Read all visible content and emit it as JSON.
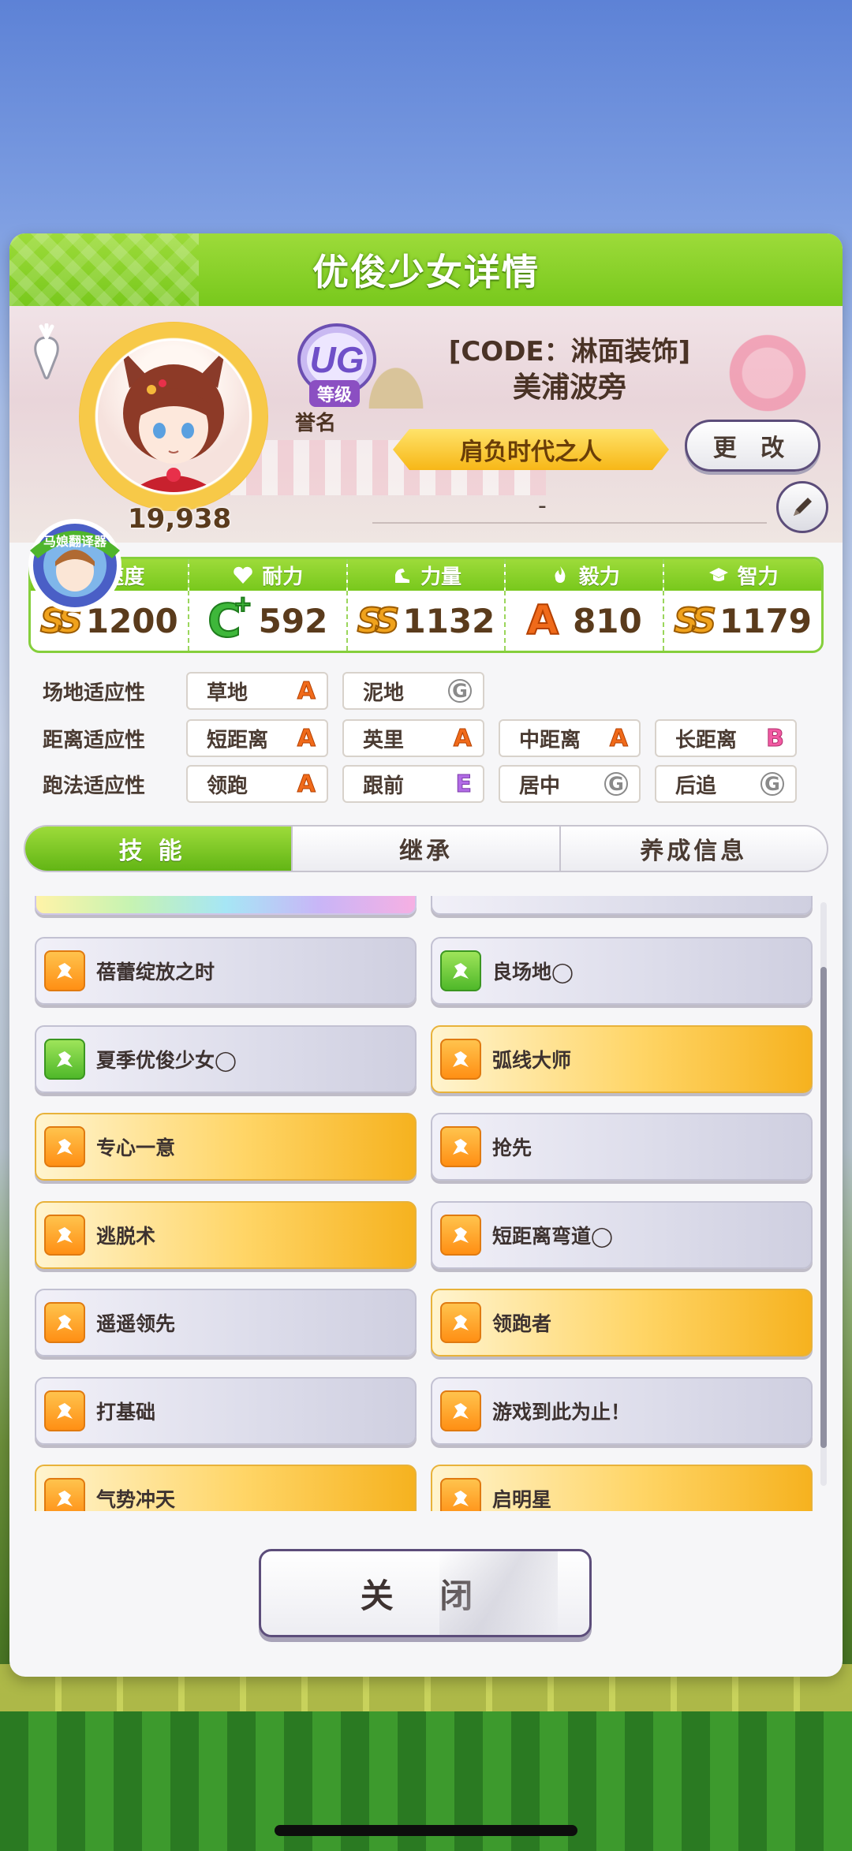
{
  "dialog": {
    "title": "优俊少女详情"
  },
  "profile": {
    "fans": "19,938",
    "rank_emblem_text": "UG",
    "rank_label": "等级",
    "honor_label": "誉名",
    "costume": "[CODE：淋面装饰]",
    "name": "美浦波旁",
    "title_plate": "肩负时代之人",
    "change_button": "更 改",
    "comment": "-"
  },
  "badge": {
    "text": "马娘翻译器"
  },
  "stats": [
    {
      "label": "速度",
      "grade": "SS",
      "value": "1200",
      "icon": "speed-icon"
    },
    {
      "label": "耐力",
      "grade": "C",
      "grade_plus": "+",
      "value": "592",
      "icon": "heart-icon"
    },
    {
      "label": "力量",
      "grade": "SS",
      "value": "1132",
      "icon": "arm-icon"
    },
    {
      "label": "毅力",
      "grade": "A",
      "value": "810",
      "icon": "flame-icon"
    },
    {
      "label": "智力",
      "grade": "SS",
      "grade_plus": "+",
      "value": "1179",
      "icon": "graduation-cap-icon"
    }
  ],
  "aptitude": {
    "track": {
      "label": "场地适应性",
      "items": [
        {
          "name": "草地",
          "grade": "A"
        },
        {
          "name": "泥地",
          "grade": "G"
        }
      ]
    },
    "distance": {
      "label": "距离适应性",
      "items": [
        {
          "name": "短距离",
          "grade": "A"
        },
        {
          "name": "英里",
          "grade": "A"
        },
        {
          "name": "中距离",
          "grade": "A"
        },
        {
          "name": "长距离",
          "grade": "B"
        }
      ]
    },
    "style": {
      "label": "跑法适应性",
      "items": [
        {
          "name": "领跑",
          "grade": "A"
        },
        {
          "name": "跟前",
          "grade": "E"
        },
        {
          "name": "居中",
          "grade": "G"
        },
        {
          "name": "后追",
          "grade": "G"
        }
      ]
    }
  },
  "tabs": [
    {
      "label": "技能",
      "active": true
    },
    {
      "label": "继承",
      "active": false
    },
    {
      "label": "养成信息",
      "active": false
    }
  ],
  "skills": [
    {
      "name": "蓓蕾绽放之时",
      "style": "normal",
      "icon": "orange"
    },
    {
      "name": "良场地◯",
      "style": "normal",
      "icon": "green"
    },
    {
      "name": "夏季优俊少女◯",
      "style": "normal",
      "icon": "green"
    },
    {
      "name": "弧线大师",
      "style": "gold",
      "icon": "orange"
    },
    {
      "name": "专心一意",
      "style": "gold",
      "icon": "orange"
    },
    {
      "name": "抢先",
      "style": "normal",
      "icon": "orange"
    },
    {
      "name": "逃脱术",
      "style": "gold",
      "icon": "orange"
    },
    {
      "name": "短距离弯道◯",
      "style": "normal",
      "icon": "orange"
    },
    {
      "name": "遥遥领先",
      "style": "normal",
      "icon": "orange"
    },
    {
      "name": "领跑者",
      "style": "gold",
      "icon": "orange"
    },
    {
      "name": "打基础",
      "style": "normal",
      "icon": "orange"
    },
    {
      "name": "游戏到此为止！",
      "style": "normal",
      "icon": "orange"
    },
    {
      "name": "气势冲天",
      "style": "gold",
      "icon": "orange"
    },
    {
      "name": "启明星",
      "style": "gold",
      "icon": "orange"
    }
  ],
  "close_button": "关 闭",
  "colors": {
    "accent_green": "#78c81c",
    "gold_skill": "#f6b21f",
    "dialog_bg": "#f6f6f8"
  }
}
